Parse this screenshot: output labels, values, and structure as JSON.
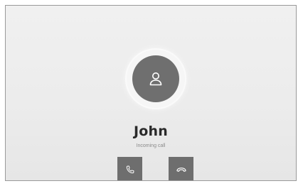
{
  "caller": {
    "name": "John",
    "status": "Incoming call"
  },
  "icons": {
    "avatar": "person-icon",
    "accept": "phone-icon",
    "decline": "hang-up-icon"
  },
  "colors": {
    "background": "#ececec",
    "avatar_circle": "#6f6f6f",
    "button": "#6e6e6e",
    "icon": "#ffffff",
    "name_text": "#2a2a2a",
    "status_text": "#8a8a8a"
  }
}
